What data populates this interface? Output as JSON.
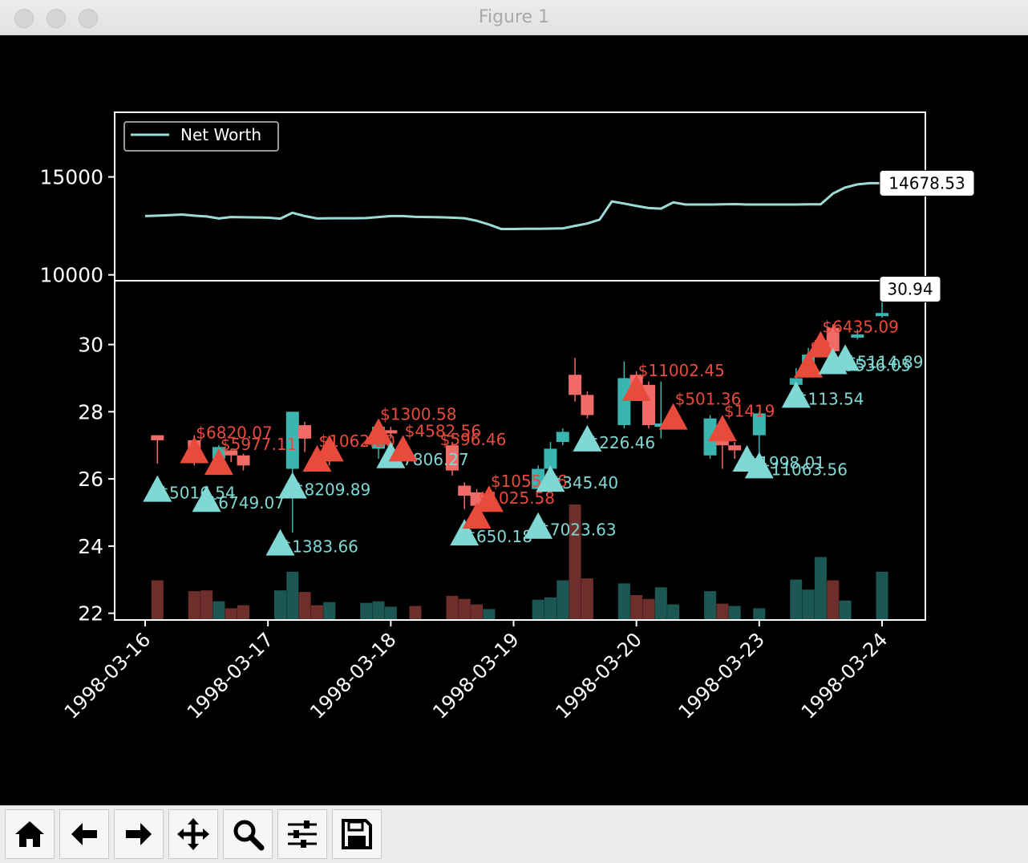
{
  "window": {
    "title": "Figure 1"
  },
  "toolbar": {
    "buttons": [
      {
        "name": "home-button",
        "icon": "home-icon"
      },
      {
        "name": "back-button",
        "icon": "arrow-left-icon"
      },
      {
        "name": "forward-button",
        "icon": "arrow-right-icon"
      },
      {
        "name": "pan-button",
        "icon": "move-icon"
      },
      {
        "name": "zoom-button",
        "icon": "magnifier-icon"
      },
      {
        "name": "configure-subplots-button",
        "icon": "sliders-icon"
      },
      {
        "name": "save-button",
        "icon": "floppy-disk-icon"
      }
    ]
  },
  "colors": {
    "background": "#000000",
    "net_worth_line": "#9ddcd6",
    "up_candle": "#3ab5b0",
    "down_candle": "#f06a68",
    "buy_marker": "#7fd8d3",
    "sell_marker": "#e84a3c",
    "up_volume": "#1c5753",
    "down_volume": "#6e2e2b"
  },
  "chart_data": [
    {
      "type": "line",
      "id": "net-worth",
      "legend": [
        "Net Worth"
      ],
      "legend_position": "top-left",
      "y_ticks": [
        10000,
        15000
      ],
      "ylim": [
        9700,
        18300
      ],
      "x_range": [
        0,
        60
      ],
      "series": [
        {
          "name": "Net Worth",
          "values": [
            13000,
            13020,
            13050,
            13080,
            13020,
            12980,
            12880,
            12950,
            12940,
            12930,
            12920,
            12870,
            13170,
            13000,
            12880,
            12890,
            12890,
            12890,
            12900,
            12950,
            13000,
            13000,
            12960,
            12950,
            12940,
            12920,
            12890,
            12760,
            12570,
            12340,
            12340,
            12350,
            12350,
            12360,
            12370,
            12500,
            12620,
            12820,
            13750,
            13640,
            13520,
            13410,
            13380,
            13700,
            13590,
            13590,
            13590,
            13600,
            13610,
            13590,
            13590,
            13590,
            13590,
            13590,
            13600,
            13600,
            14150,
            14460,
            14620,
            14680,
            14678.53
          ]
        }
      ],
      "last_value_label": "14678.53"
    },
    {
      "type": "candlestick",
      "id": "price",
      "y_ticks": [
        22,
        24,
        26,
        28,
        30
      ],
      "ylim": [
        21.8,
        31.9
      ],
      "x_range": [
        0,
        60
      ],
      "x_tick_labels": [
        "1998-03-16",
        "1998-03-17",
        "1998-03-18",
        "1998-03-19",
        "1998-03-20",
        "1998-03-23",
        "1998-03-24"
      ],
      "x_tick_positions": [
        0,
        10,
        20,
        30,
        40,
        50,
        60
      ],
      "last_price_label": "30.94",
      "candles": [
        {
          "x": 1,
          "o": 27.3,
          "c": 27.15,
          "h": 27.3,
          "l": 26.45
        },
        {
          "x": 4,
          "o": 27.15,
          "c": 26.8,
          "h": 27.3,
          "l": 26.4
        },
        {
          "x": 6,
          "o": 26.6,
          "c": 26.95,
          "h": 27.0,
          "l": 26.2
        },
        {
          "x": 7,
          "o": 26.85,
          "c": 26.7,
          "h": 26.9,
          "l": 26.5
        },
        {
          "x": 8,
          "o": 26.7,
          "c": 26.4,
          "h": 26.75,
          "l": 26.25
        },
        {
          "x": 12,
          "o": 26.3,
          "c": 28.0,
          "h": 28.0,
          "l": 24.4
        },
        {
          "x": 13,
          "o": 27.6,
          "c": 27.2,
          "h": 27.7,
          "l": 26.8
        },
        {
          "x": 15,
          "o": 26.95,
          "c": 26.7,
          "h": 27.05,
          "l": 26.4
        },
        {
          "x": 19,
          "o": 26.9,
          "c": 27.55,
          "h": 27.7,
          "l": 26.6
        },
        {
          "x": 20,
          "o": 27.45,
          "c": 27.4,
          "h": 27.55,
          "l": 27.2
        },
        {
          "x": 25,
          "o": 27.0,
          "c": 26.25,
          "h": 27.1,
          "l": 26.1
        },
        {
          "x": 26,
          "o": 25.8,
          "c": 25.5,
          "h": 25.9,
          "l": 25.1
        },
        {
          "x": 27,
          "o": 25.6,
          "c": 25.2,
          "h": 25.7,
          "l": 25.0
        },
        {
          "x": 32,
          "o": 25.7,
          "c": 26.3,
          "h": 26.4,
          "l": 25.6
        },
        {
          "x": 33,
          "o": 26.3,
          "c": 26.9,
          "h": 27.1,
          "l": 26.2
        },
        {
          "x": 34,
          "o": 27.1,
          "c": 27.4,
          "h": 27.5,
          "l": 27.0
        },
        {
          "x": 35,
          "o": 29.1,
          "c": 28.5,
          "h": 29.6,
          "l": 28.3
        },
        {
          "x": 36,
          "o": 28.5,
          "c": 27.9,
          "h": 28.6,
          "l": 27.8
        },
        {
          "x": 39,
          "o": 27.6,
          "c": 29.0,
          "h": 29.5,
          "l": 27.5
        },
        {
          "x": 40,
          "o": 29.1,
          "c": 28.8,
          "h": 29.2,
          "l": 28.6
        },
        {
          "x": 41,
          "o": 28.8,
          "c": 27.6,
          "h": 28.9,
          "l": 27.5
        },
        {
          "x": 42,
          "o": 27.55,
          "c": 27.65,
          "h": 28.9,
          "l": 27.2
        },
        {
          "x": 46,
          "o": 26.7,
          "c": 27.8,
          "h": 27.9,
          "l": 26.6
        },
        {
          "x": 47,
          "o": 27.4,
          "c": 27.0,
          "h": 27.5,
          "l": 26.3
        },
        {
          "x": 48,
          "o": 27.0,
          "c": 26.85,
          "h": 27.1,
          "l": 26.6
        },
        {
          "x": 50,
          "o": 27.3,
          "c": 27.95,
          "h": 28.0,
          "l": 26.7
        },
        {
          "x": 53,
          "o": 28.8,
          "c": 29.0,
          "h": 29.3,
          "l": 28.7
        },
        {
          "x": 54,
          "o": 29.4,
          "c": 29.7,
          "h": 29.9,
          "l": 29.1
        },
        {
          "x": 56,
          "o": 30.5,
          "c": 29.8,
          "h": 30.6,
          "l": 29.5
        },
        {
          "x": 58,
          "o": 30.3,
          "c": 30.3,
          "h": 30.45,
          "l": 30.15
        },
        {
          "x": 60,
          "o": 30.85,
          "c": 30.94,
          "h": 31.3,
          "l": 30.8
        }
      ],
      "volume": {
        "max": 2.95,
        "bars": [
          {
            "x": 1,
            "v": 1.0,
            "up": false
          },
          {
            "x": 4,
            "v": 0.72,
            "up": false
          },
          {
            "x": 5,
            "v": 0.74,
            "up": false
          },
          {
            "x": 6,
            "v": 0.46,
            "up": true
          },
          {
            "x": 7,
            "v": 0.28,
            "up": false
          },
          {
            "x": 8,
            "v": 0.36,
            "up": false
          },
          {
            "x": 11,
            "v": 0.74,
            "up": true
          },
          {
            "x": 12,
            "v": 1.22,
            "up": true
          },
          {
            "x": 13,
            "v": 0.7,
            "up": false
          },
          {
            "x": 14,
            "v": 0.36,
            "up": false
          },
          {
            "x": 15,
            "v": 0.44,
            "up": true
          },
          {
            "x": 18,
            "v": 0.42,
            "up": true
          },
          {
            "x": 19,
            "v": 0.46,
            "up": true
          },
          {
            "x": 20,
            "v": 0.32,
            "up": true
          },
          {
            "x": 22,
            "v": 0.34,
            "up": false
          },
          {
            "x": 25,
            "v": 0.6,
            "up": false
          },
          {
            "x": 26,
            "v": 0.52,
            "up": false
          },
          {
            "x": 27,
            "v": 0.38,
            "up": false
          },
          {
            "x": 28,
            "v": 0.26,
            "up": true
          },
          {
            "x": 32,
            "v": 0.5,
            "up": true
          },
          {
            "x": 33,
            "v": 0.56,
            "up": true
          },
          {
            "x": 34,
            "v": 1.0,
            "up": true
          },
          {
            "x": 35,
            "v": 2.95,
            "up": false
          },
          {
            "x": 36,
            "v": 1.05,
            "up": false
          },
          {
            "x": 39,
            "v": 0.92,
            "up": true
          },
          {
            "x": 40,
            "v": 0.62,
            "up": false
          },
          {
            "x": 41,
            "v": 0.52,
            "up": false
          },
          {
            "x": 42,
            "v": 0.82,
            "up": true
          },
          {
            "x": 43,
            "v": 0.38,
            "up": true
          },
          {
            "x": 46,
            "v": 0.72,
            "up": true
          },
          {
            "x": 47,
            "v": 0.4,
            "up": false
          },
          {
            "x": 48,
            "v": 0.34,
            "up": true
          },
          {
            "x": 50,
            "v": 0.28,
            "up": true
          },
          {
            "x": 53,
            "v": 1.02,
            "up": true
          },
          {
            "x": 54,
            "v": 0.76,
            "up": true
          },
          {
            "x": 55,
            "v": 1.6,
            "up": true
          },
          {
            "x": 56,
            "v": 1.0,
            "up": false
          },
          {
            "x": 57,
            "v": 0.48,
            "up": true
          },
          {
            "x": 60,
            "v": 1.22,
            "up": true
          }
        ]
      },
      "trades": [
        {
          "type": "buy",
          "x": 1,
          "y": 25.7,
          "label": "$5016.54"
        },
        {
          "type": "sell",
          "x": 4,
          "y": 26.85,
          "label": "$6820.07"
        },
        {
          "type": "buy",
          "x": 5,
          "y": 25.4,
          "label": "$6749.07"
        },
        {
          "type": "sell",
          "x": 6,
          "y": 26.5,
          "label": "$5977.11"
        },
        {
          "type": "buy",
          "x": 11,
          "y": 24.1,
          "label": "$1383.66"
        },
        {
          "type": "buy",
          "x": 12,
          "y": 25.8,
          "label": "$8209.89"
        },
        {
          "type": "sell",
          "x": 14,
          "y": 26.6,
          "label": "$1062.20"
        },
        {
          "type": "sell",
          "x": 15,
          "y": 26.9,
          "label": ""
        },
        {
          "type": "sell",
          "x": 19,
          "y": 27.4,
          "label": "$1300.58"
        },
        {
          "type": "buy",
          "x": 20,
          "y": 26.7,
          "label": "$7806.27"
        },
        {
          "type": "sell",
          "x": 21,
          "y": 26.9,
          "label": "$4582.56"
        },
        {
          "type": "buy",
          "x": 26,
          "y": 24.4,
          "label": "$650.18"
        },
        {
          "type": "sell",
          "x": 27,
          "y": 24.9,
          "label": "$1025.58"
        },
        {
          "type": "sell",
          "x": 28,
          "y": 25.4,
          "label": "$1055.56"
        },
        {
          "type": "buy",
          "x": 32,
          "y": 24.6,
          "label": "$7023.63"
        },
        {
          "type": "buy",
          "x": 33,
          "y": 26.0,
          "label": "$345.40"
        },
        {
          "type": "buy",
          "x": 36,
          "y": 27.2,
          "label": "$226.46"
        },
        {
          "type": "sell",
          "x": 40,
          "y": 28.7,
          "label": "$11002.45"
        },
        {
          "type": "sell",
          "x": 43,
          "y": 27.85,
          "label": "$501.36"
        },
        {
          "type": "sell",
          "x": 47,
          "y": 27.5,
          "label": "$1419"
        },
        {
          "type": "buy",
          "x": 49,
          "y": 26.6,
          "label": "$1998.01"
        },
        {
          "type": "buy",
          "x": 50,
          "y": 26.4,
          "label": "$11063.56"
        },
        {
          "type": "buy",
          "x": 53,
          "y": 28.5,
          "label": "$113.54"
        },
        {
          "type": "sell",
          "x": 54,
          "y": 29.4,
          "label": "$8"
        },
        {
          "type": "sell",
          "x": 55,
          "y": 30.0,
          "label": "$6435.09"
        },
        {
          "type": "buy",
          "x": 56,
          "y": 29.5,
          "label": "$5536.05"
        },
        {
          "type": "buy",
          "x": 57,
          "y": 29.6,
          "label": "$5114.89"
        }
      ],
      "annotations": [
        "$596.46"
      ]
    }
  ]
}
